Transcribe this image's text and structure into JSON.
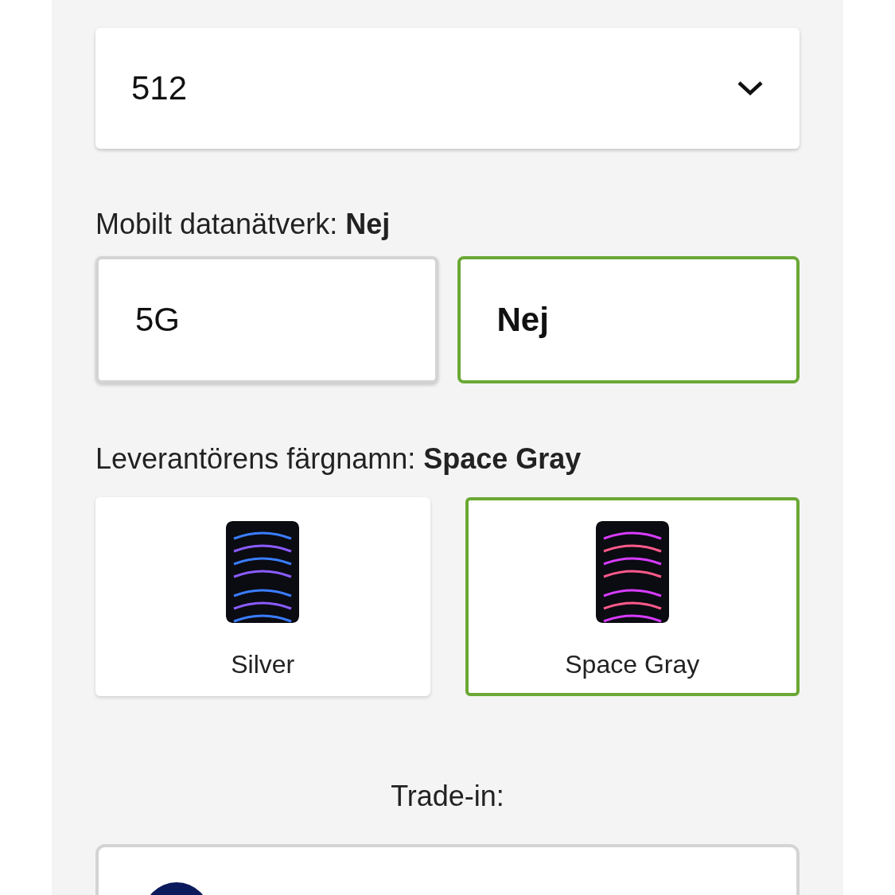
{
  "storage_select": {
    "value": "512"
  },
  "network": {
    "label": "Mobilt datanätverk:",
    "value": "Nej",
    "options": [
      {
        "label": "5G",
        "selected": false
      },
      {
        "label": "Nej",
        "selected": true
      }
    ]
  },
  "color": {
    "label": "Leverantörens färgnamn:",
    "value": "Space Gray",
    "options": [
      {
        "label": "Silver",
        "selected": false
      },
      {
        "label": "Space Gray",
        "selected": true
      }
    ]
  },
  "trade_in": {
    "label": "Trade-in:"
  }
}
